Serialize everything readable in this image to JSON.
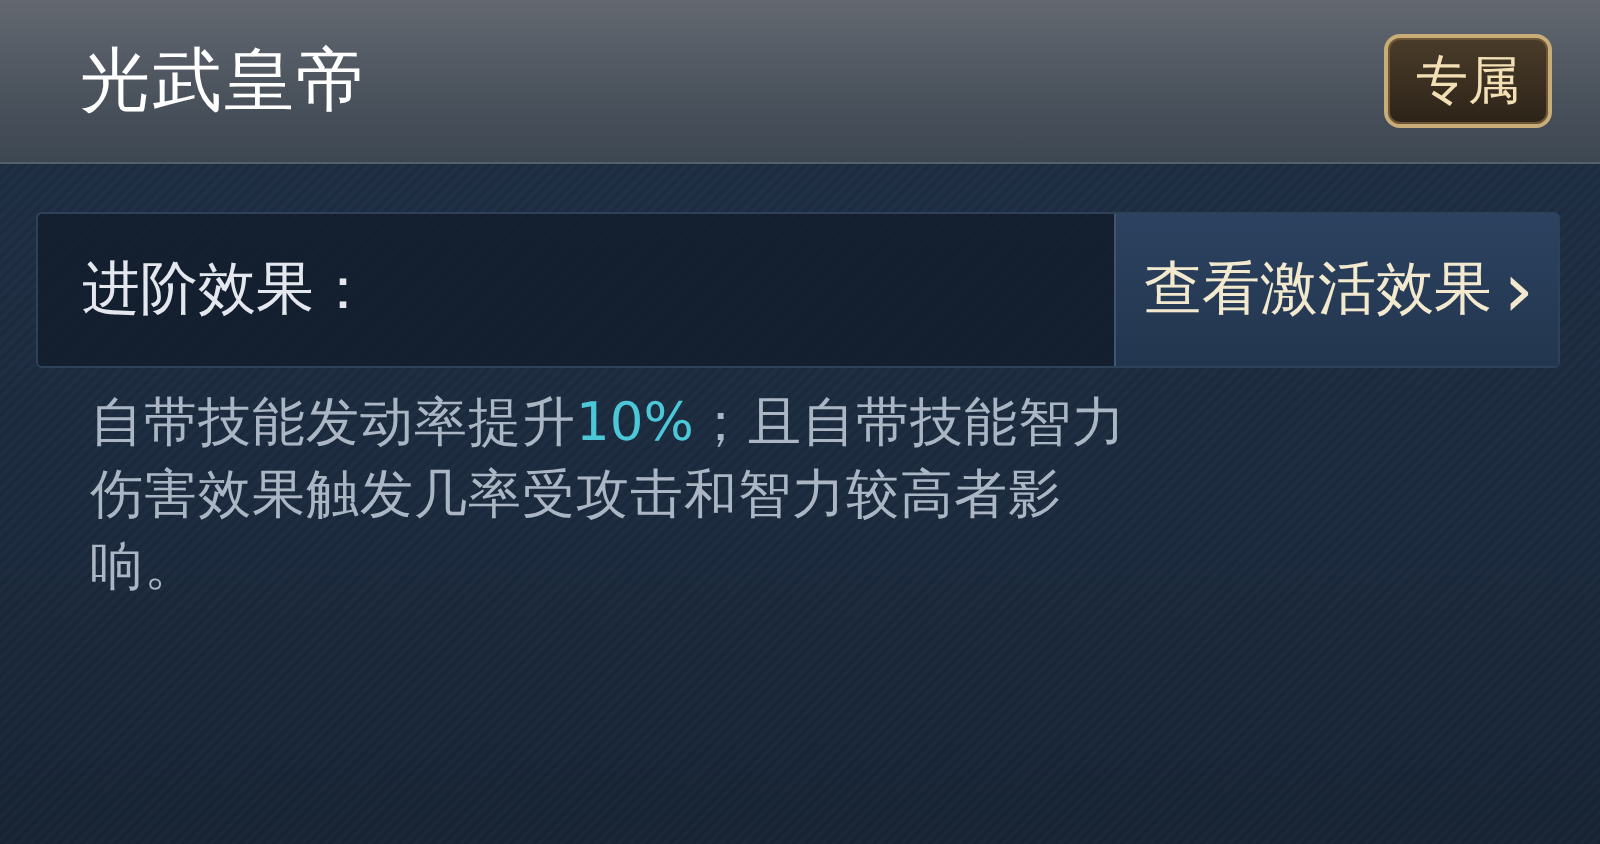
{
  "header": {
    "title": "光武皇帝",
    "badge": "专属"
  },
  "advance": {
    "label": "进阶效果：",
    "button": "查看激活效果",
    "button_icon": "›"
  },
  "description": [
    {
      "text": "自带技能发动率提升",
      "highlight": false
    },
    {
      "text": "10%",
      "highlight": true
    },
    {
      "text": "；且自带技能智力伤害效果触发几率受攻击和智力较高者影响。",
      "highlight": false
    }
  ]
}
